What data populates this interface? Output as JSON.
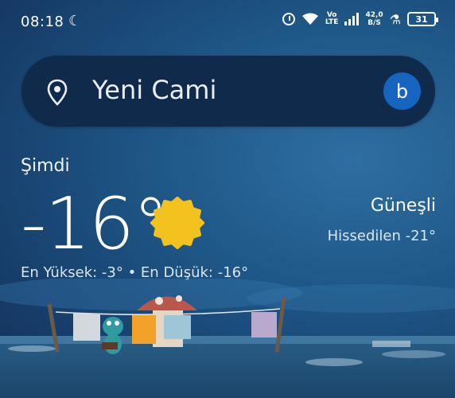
{
  "status_bar": {
    "time": "08:18",
    "moon_icon": "crescent-moon-icon",
    "volte": [
      "Vo",
      "LTE"
    ],
    "net_speed": [
      "42,0",
      "B/S"
    ],
    "battery": "31"
  },
  "search": {
    "location": "Yeni Cami",
    "account_initial": "b",
    "icons": [
      "location-pin-icon"
    ]
  },
  "weather": {
    "now_label": "Şimdi",
    "temperature": "-16°",
    "condition": "Güneşli",
    "feels_like": "Hissedilen -21°",
    "high_low": "En Yüksek: -3° • En Düşük: -16°",
    "icon": "sun-icon"
  },
  "colors": {
    "accent": "#1565c0",
    "background": "#1e5787",
    "search_bg": "#0f2a4a",
    "sun": "#f4c21e"
  }
}
